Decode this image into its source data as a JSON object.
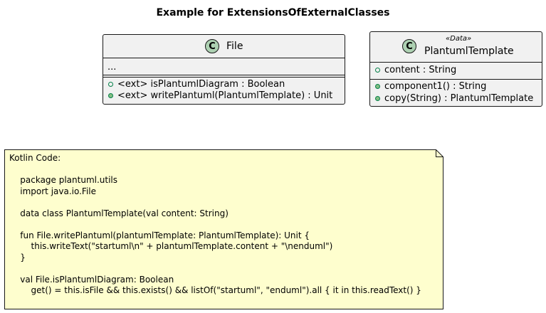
{
  "title": "Example for ExtensionsOfExternalClasses",
  "file_class": {
    "icon_letter": "C",
    "name": "File",
    "field_placeholder": "...",
    "methods": [
      "<ext> isPlantumlDiagram : Boolean",
      "<ext> writePlantuml(PlantumlTemplate) : Unit"
    ]
  },
  "template_class": {
    "icon_letter": "C",
    "stereotype": "«Data»",
    "name": "PlantumlTemplate",
    "fields": [
      "content : String"
    ],
    "methods": [
      "component1() : String",
      "copy(String) : PlantumlTemplate"
    ]
  },
  "note": {
    "text": "Kotlin Code:\n\n    package plantuml.utils\n    import java.io.File\n\n    data class PlantumlTemplate(val content: String)\n\n    fun File.writePlantuml(plantumlTemplate: PlantumlTemplate): Unit {\n        this.writeText(\"startuml\\n\" + plantumlTemplate.content + \"\\nenduml\")\n    }\n\n    val File.isPlantumlDiagram: Boolean\n        get() = this.isFile && this.exists() && listOf(\"startuml\", \"enduml\").all { it in this.readText() }"
  },
  "colors": {
    "class_bg": "#f1f1f1",
    "class_icon": "#add1b2",
    "note_bg": "#fefece",
    "visibility_green": "#038048"
  }
}
